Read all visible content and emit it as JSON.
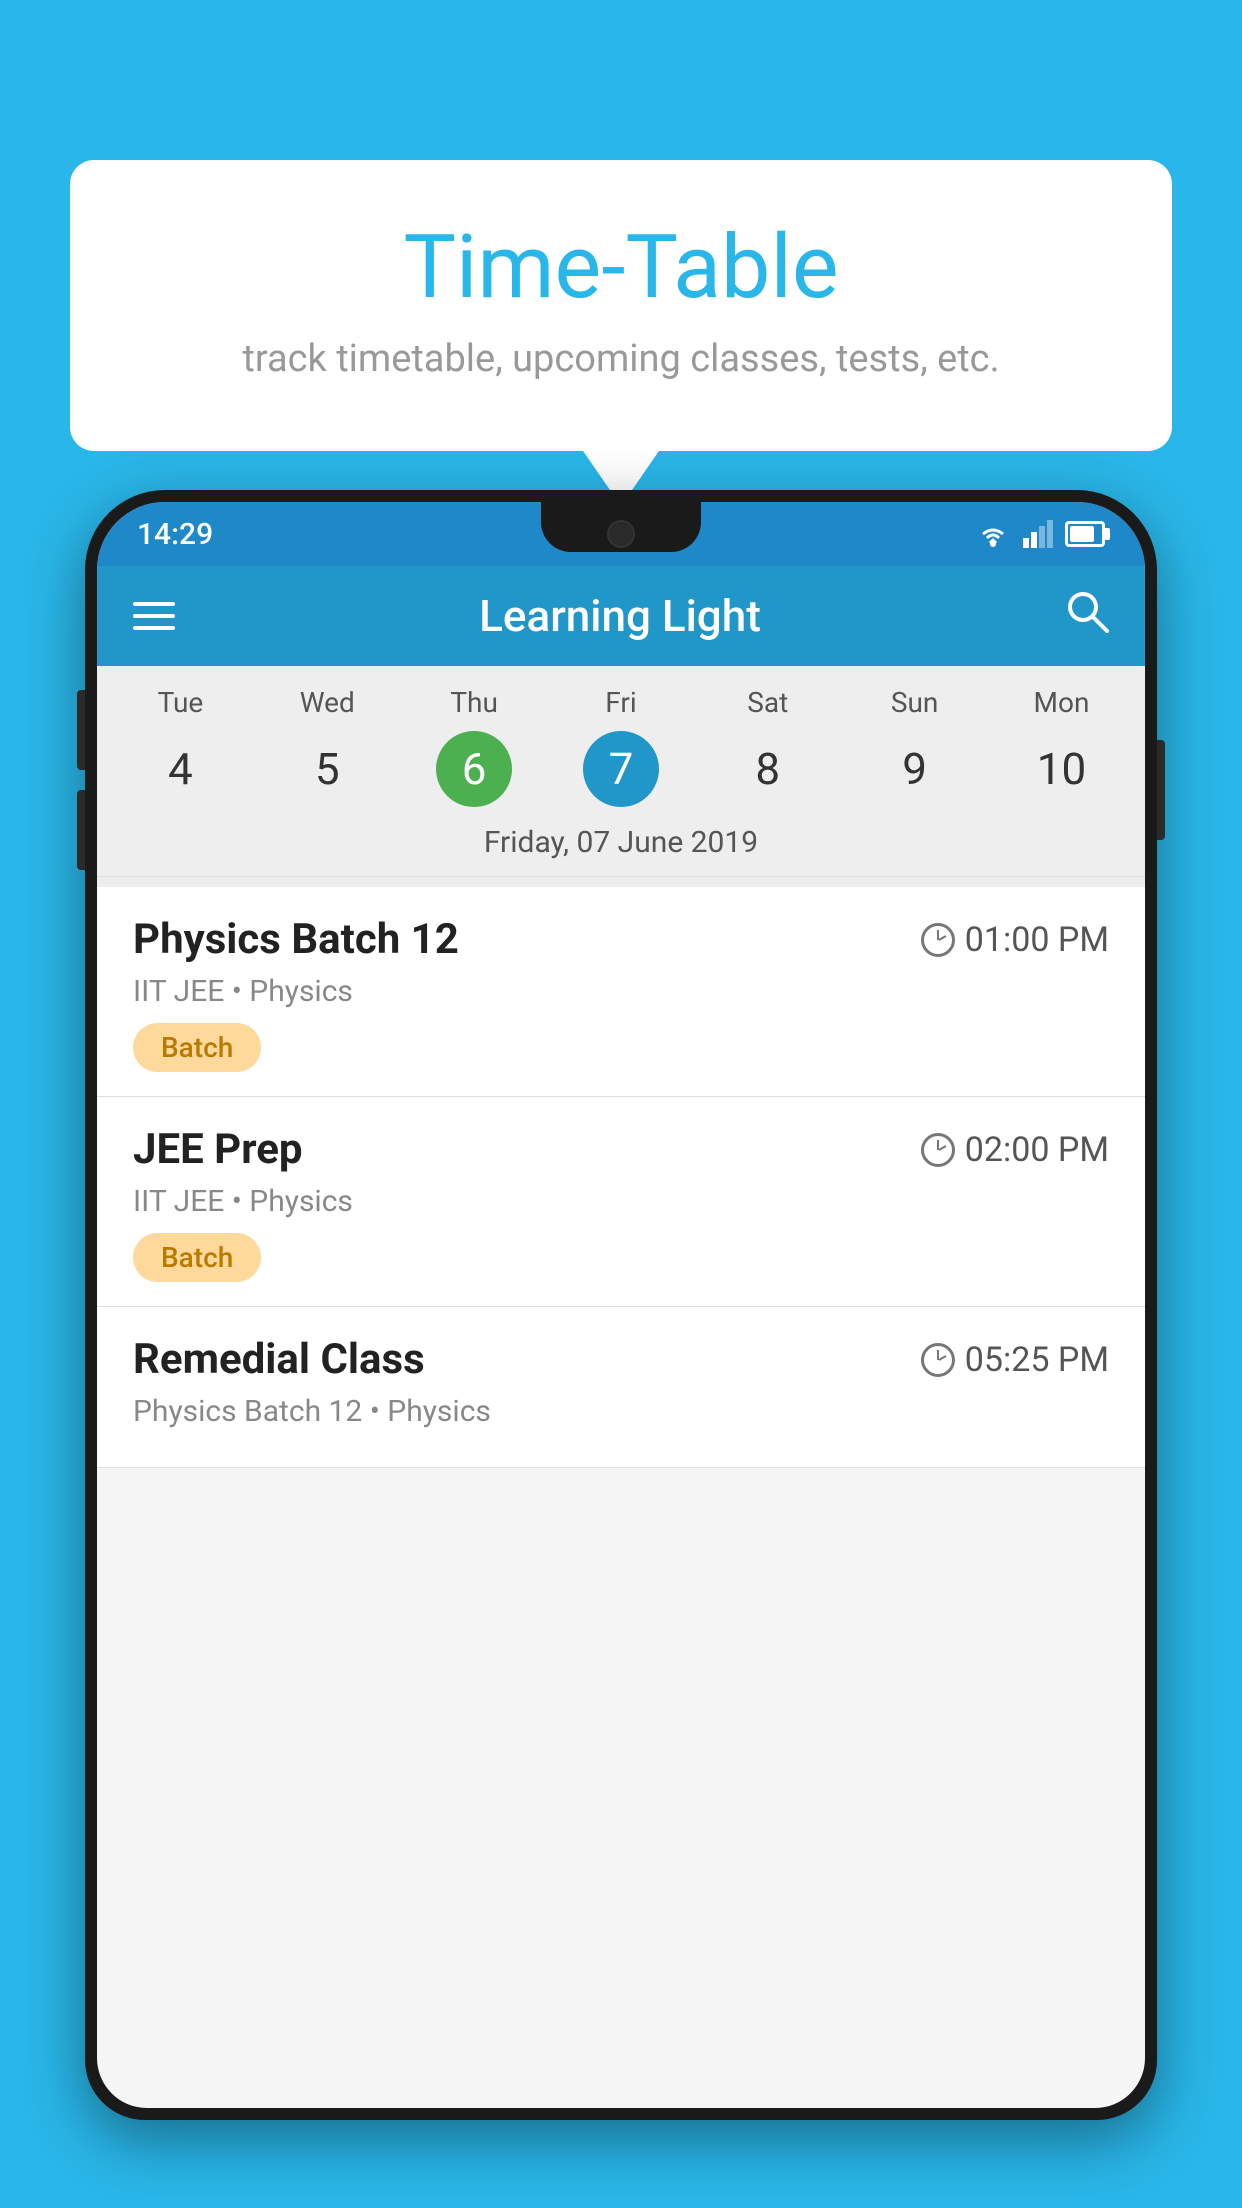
{
  "background_color": "#29b6e8",
  "speech_bubble": {
    "title": "Time-Table",
    "subtitle": "track timetable, upcoming classes, tests, etc."
  },
  "phone": {
    "status_bar": {
      "time": "14:29"
    },
    "app_bar": {
      "title": "Learning Light"
    },
    "calendar": {
      "days": [
        {
          "name": "Tue",
          "number": "4",
          "state": "normal"
        },
        {
          "name": "Wed",
          "number": "5",
          "state": "normal"
        },
        {
          "name": "Thu",
          "number": "6",
          "state": "today"
        },
        {
          "name": "Fri",
          "number": "7",
          "state": "selected"
        },
        {
          "name": "Sat",
          "number": "8",
          "state": "normal"
        },
        {
          "name": "Sun",
          "number": "9",
          "state": "normal"
        },
        {
          "name": "Mon",
          "number": "10",
          "state": "normal"
        }
      ],
      "selected_date_label": "Friday, 07 June 2019"
    },
    "schedule": [
      {
        "title": "Physics Batch 12",
        "time": "01:00 PM",
        "meta": "IIT JEE • Physics",
        "tag": "Batch"
      },
      {
        "title": "JEE Prep",
        "time": "02:00 PM",
        "meta": "IIT JEE • Physics",
        "tag": "Batch"
      },
      {
        "title": "Remedial Class",
        "time": "05:25 PM",
        "meta": "Physics Batch 12 • Physics",
        "tag": null
      }
    ]
  }
}
